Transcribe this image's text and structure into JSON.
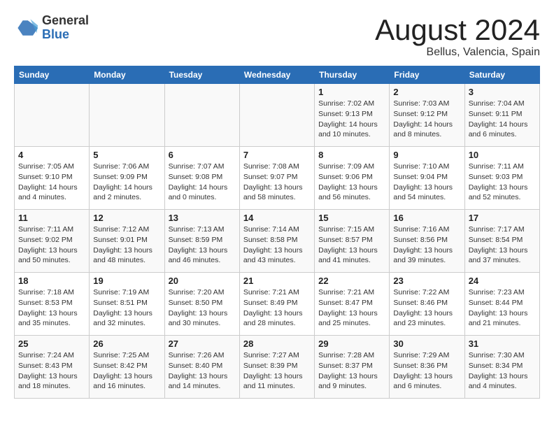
{
  "header": {
    "logo_general": "General",
    "logo_blue": "Blue",
    "title": "August 2024",
    "subtitle": "Bellus, Valencia, Spain"
  },
  "calendar": {
    "days_of_week": [
      "Sunday",
      "Monday",
      "Tuesday",
      "Wednesday",
      "Thursday",
      "Friday",
      "Saturday"
    ],
    "weeks": [
      [
        {
          "day": "",
          "info": ""
        },
        {
          "day": "",
          "info": ""
        },
        {
          "day": "",
          "info": ""
        },
        {
          "day": "",
          "info": ""
        },
        {
          "day": "1",
          "info": "Sunrise: 7:02 AM\nSunset: 9:13 PM\nDaylight: 14 hours\nand 10 minutes."
        },
        {
          "day": "2",
          "info": "Sunrise: 7:03 AM\nSunset: 9:12 PM\nDaylight: 14 hours\nand 8 minutes."
        },
        {
          "day": "3",
          "info": "Sunrise: 7:04 AM\nSunset: 9:11 PM\nDaylight: 14 hours\nand 6 minutes."
        }
      ],
      [
        {
          "day": "4",
          "info": "Sunrise: 7:05 AM\nSunset: 9:10 PM\nDaylight: 14 hours\nand 4 minutes."
        },
        {
          "day": "5",
          "info": "Sunrise: 7:06 AM\nSunset: 9:09 PM\nDaylight: 14 hours\nand 2 minutes."
        },
        {
          "day": "6",
          "info": "Sunrise: 7:07 AM\nSunset: 9:08 PM\nDaylight: 14 hours\nand 0 minutes."
        },
        {
          "day": "7",
          "info": "Sunrise: 7:08 AM\nSunset: 9:07 PM\nDaylight: 13 hours\nand 58 minutes."
        },
        {
          "day": "8",
          "info": "Sunrise: 7:09 AM\nSunset: 9:06 PM\nDaylight: 13 hours\nand 56 minutes."
        },
        {
          "day": "9",
          "info": "Sunrise: 7:10 AM\nSunset: 9:04 PM\nDaylight: 13 hours\nand 54 minutes."
        },
        {
          "day": "10",
          "info": "Sunrise: 7:11 AM\nSunset: 9:03 PM\nDaylight: 13 hours\nand 52 minutes."
        }
      ],
      [
        {
          "day": "11",
          "info": "Sunrise: 7:11 AM\nSunset: 9:02 PM\nDaylight: 13 hours\nand 50 minutes."
        },
        {
          "day": "12",
          "info": "Sunrise: 7:12 AM\nSunset: 9:01 PM\nDaylight: 13 hours\nand 48 minutes."
        },
        {
          "day": "13",
          "info": "Sunrise: 7:13 AM\nSunset: 8:59 PM\nDaylight: 13 hours\nand 46 minutes."
        },
        {
          "day": "14",
          "info": "Sunrise: 7:14 AM\nSunset: 8:58 PM\nDaylight: 13 hours\nand 43 minutes."
        },
        {
          "day": "15",
          "info": "Sunrise: 7:15 AM\nSunset: 8:57 PM\nDaylight: 13 hours\nand 41 minutes."
        },
        {
          "day": "16",
          "info": "Sunrise: 7:16 AM\nSunset: 8:56 PM\nDaylight: 13 hours\nand 39 minutes."
        },
        {
          "day": "17",
          "info": "Sunrise: 7:17 AM\nSunset: 8:54 PM\nDaylight: 13 hours\nand 37 minutes."
        }
      ],
      [
        {
          "day": "18",
          "info": "Sunrise: 7:18 AM\nSunset: 8:53 PM\nDaylight: 13 hours\nand 35 minutes."
        },
        {
          "day": "19",
          "info": "Sunrise: 7:19 AM\nSunset: 8:51 PM\nDaylight: 13 hours\nand 32 minutes."
        },
        {
          "day": "20",
          "info": "Sunrise: 7:20 AM\nSunset: 8:50 PM\nDaylight: 13 hours\nand 30 minutes."
        },
        {
          "day": "21",
          "info": "Sunrise: 7:21 AM\nSunset: 8:49 PM\nDaylight: 13 hours\nand 28 minutes."
        },
        {
          "day": "22",
          "info": "Sunrise: 7:21 AM\nSunset: 8:47 PM\nDaylight: 13 hours\nand 25 minutes."
        },
        {
          "day": "23",
          "info": "Sunrise: 7:22 AM\nSunset: 8:46 PM\nDaylight: 13 hours\nand 23 minutes."
        },
        {
          "day": "24",
          "info": "Sunrise: 7:23 AM\nSunset: 8:44 PM\nDaylight: 13 hours\nand 21 minutes."
        }
      ],
      [
        {
          "day": "25",
          "info": "Sunrise: 7:24 AM\nSunset: 8:43 PM\nDaylight: 13 hours\nand 18 minutes."
        },
        {
          "day": "26",
          "info": "Sunrise: 7:25 AM\nSunset: 8:42 PM\nDaylight: 13 hours\nand 16 minutes."
        },
        {
          "day": "27",
          "info": "Sunrise: 7:26 AM\nSunset: 8:40 PM\nDaylight: 13 hours\nand 14 minutes."
        },
        {
          "day": "28",
          "info": "Sunrise: 7:27 AM\nSunset: 8:39 PM\nDaylight: 13 hours\nand 11 minutes."
        },
        {
          "day": "29",
          "info": "Sunrise: 7:28 AM\nSunset: 8:37 PM\nDaylight: 13 hours\nand 9 minutes."
        },
        {
          "day": "30",
          "info": "Sunrise: 7:29 AM\nSunset: 8:36 PM\nDaylight: 13 hours\nand 6 minutes."
        },
        {
          "day": "31",
          "info": "Sunrise: 7:30 AM\nSunset: 8:34 PM\nDaylight: 13 hours\nand 4 minutes."
        }
      ]
    ]
  }
}
